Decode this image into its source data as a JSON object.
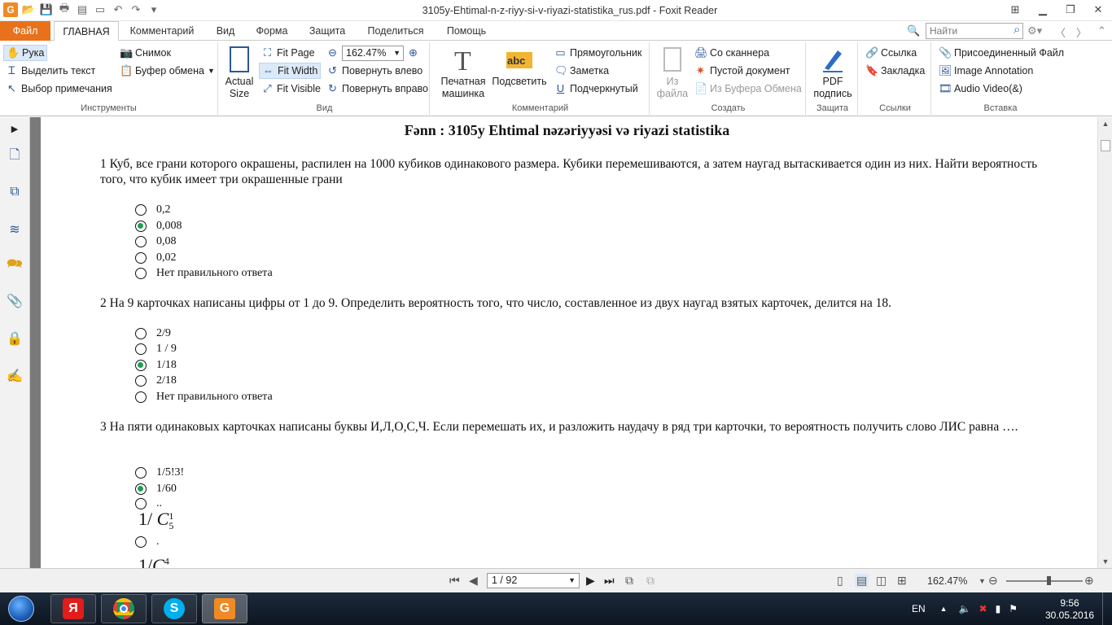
{
  "window": {
    "title": "3105y-Ehtimal-n-z-riyy-si-v-riyazi-statistika_rus.pdf - Foxit Reader"
  },
  "menu_tabs": [
    "Файл",
    "ГЛАВНАЯ",
    "Комментарий",
    "Вид",
    "Форма",
    "Защита",
    "Поделиться",
    "Помощь"
  ],
  "search": {
    "placeholder": "Найти"
  },
  "ribbon": {
    "tools": {
      "hand": "Рука",
      "select_text": "Выделить текст",
      "select_annot": "Выбор примечания",
      "snapshot": "Снимок",
      "clipboard": "Буфер обмена",
      "group": "Инструменты"
    },
    "view": {
      "actual_size_1": "Actual",
      "actual_size_2": "Size",
      "fit_page": "Fit Page",
      "fit_width": "Fit Width",
      "fit_visible": "Fit Visible",
      "zoom": "162.47%",
      "rotate_left": "Повернуть влево",
      "rotate_right": "Повернуть вправо",
      "group": "Вид"
    },
    "comment": {
      "typewriter_1": "Печатная",
      "typewriter_2": "машинка",
      "highlight": "Подсветить",
      "rectangle": "Прямоугольник",
      "note": "Заметка",
      "underline": "Подчеркнутый",
      "group": "Комментарий"
    },
    "create": {
      "from_file_1": "Из",
      "from_file_2": "файла",
      "scanner": "Со сканнера",
      "blank": "Пустой документ",
      "from_clipboard": "Из Буфера Обмена",
      "group": "Создать"
    },
    "protect": {
      "pdf_sign_1": "PDF",
      "pdf_sign_2": "подпись",
      "group": "Защита"
    },
    "links": {
      "link": "Ссылка",
      "bookmark": "Закладка",
      "group": "Ссылки"
    },
    "insert": {
      "attachment": "Присоединенный Файл",
      "image_annot": "Image Annotation",
      "audio_video": "Audio  Video(&)",
      "group": "Вставка"
    }
  },
  "document": {
    "title": "Fənn : 3105y Ehtimal nəzəriyyəsi və riyazi statistika",
    "questions": [
      {
        "text": "1 Куб, все грани которого окрашены, распилен на 1000 кубиков одинакового размера. Кубики перемешиваются, а затем наугад вытаскивается один из них. Найти вероятность того, что кубик имеет три окрашенные грани",
        "options": [
          {
            "label": "0,2",
            "selected": false
          },
          {
            "label": "0,008",
            "selected": true
          },
          {
            "label": "0,08",
            "selected": false
          },
          {
            "label": "0,02",
            "selected": false
          },
          {
            "label": "Нет правильного ответа",
            "selected": false
          }
        ]
      },
      {
        "text": "2 На 9 карточках написаны цифры от 1 до 9. Определить вероятность того, что число, составленное из двух наугад взятых карточек, делится на 18.",
        "options": [
          {
            "label": "2/9",
            "selected": false
          },
          {
            "label": "1 / 9",
            "selected": false
          },
          {
            "label": "1/18",
            "selected": true
          },
          {
            "label": "2/18",
            "selected": false
          },
          {
            "label": "Нет правильного ответа",
            "selected": false
          }
        ]
      },
      {
        "text": "3 На пяти одинаковых карточках написаны буквы И,Л,О,С,Ч. Если перемешать их, и разложить наудачу в ряд три карточки, то вероятность получить слово ЛИС равна ….",
        "options": [
          {
            "label": "1/5!3!",
            "selected": false
          },
          {
            "label": "1/60",
            "selected": true
          },
          {
            "label": "..",
            "selected": false
          },
          {
            "label": ".",
            "selected": false
          }
        ],
        "formula1": {
          "lead": "1/ ",
          "var": "C",
          "sup": "1",
          "sub": "5"
        },
        "formula2": {
          "lead": "1/",
          "var": "C",
          "sup": "4"
        }
      }
    ]
  },
  "statusbar": {
    "page": "1 / 92",
    "zoom": "162.47%"
  },
  "taskbar": {
    "tray_lang": "EN",
    "time": "9:56",
    "date": "30.05.2016"
  },
  "colors": {
    "accent": "#e8711c",
    "selected_radio": "#1e9e52",
    "ribbon_selected": "#dce9f8"
  }
}
